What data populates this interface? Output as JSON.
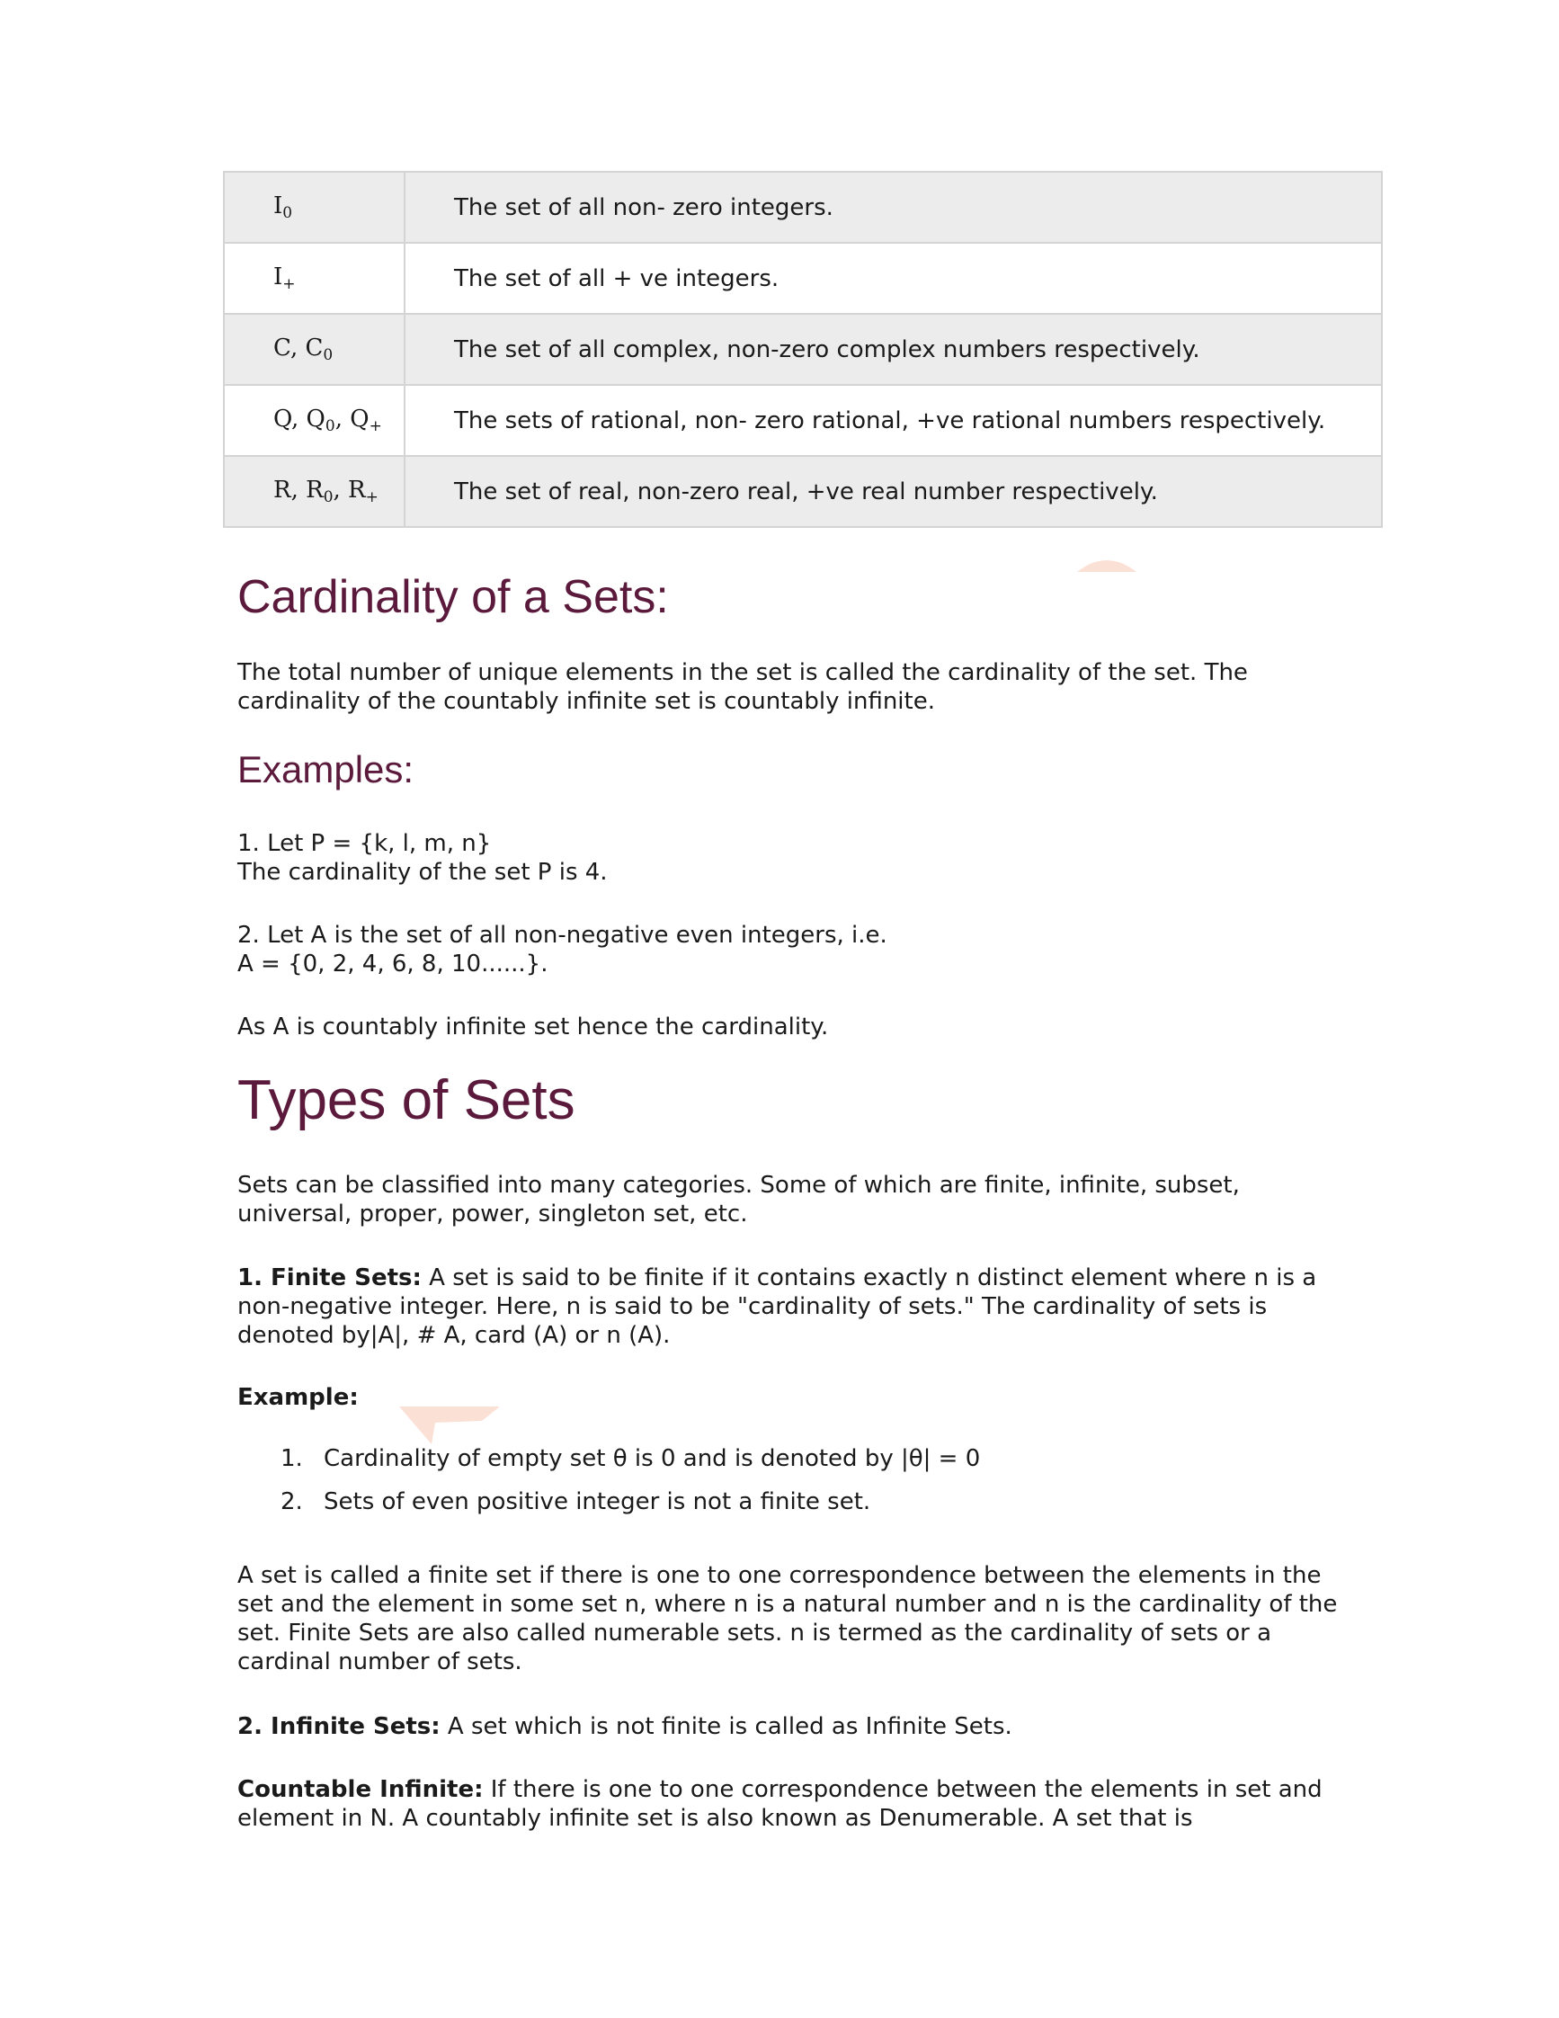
{
  "table": {
    "rows": [
      {
        "symbol": "I",
        "sub": "0",
        "desc": "The set of all non- zero integers."
      },
      {
        "symbol": "I",
        "sub": "+",
        "desc": "The set of all + ve integers."
      },
      {
        "symbol_html": "C, C<span class=\"sub\">0</span>",
        "desc": "The set of all complex, non-zero complex numbers respectively."
      },
      {
        "symbol_html": "Q, Q<span class=\"sub\">0</span>, Q<span class=\"sub\">+</span>",
        "desc": "The sets of rational, non- zero rational, +ve rational numbers respectively."
      },
      {
        "symbol_html": "R, R<span class=\"sub\">0</span>, R<span class=\"sub\">+</span>",
        "desc": "The set of real, non-zero real, +ve real number respectively."
      }
    ]
  },
  "cardinality": {
    "heading": "Cardinality of a Sets:",
    "text": "The total number of unique elements in the set is called the cardinality of the set. The cardinality of the countably infinite set is countably infinite."
  },
  "examples": {
    "heading": "Examples:",
    "ex1_line1": "1. Let P = {k, l, m, n}",
    "ex1_line2": "The cardinality of the set P is 4.",
    "ex2_line1": "2. Let A is the set of all non-negative even integers, i.e.",
    "ex2_line2": "A = {0, 2, 4, 6, 8, 10......}.",
    "ex3": "As A is countably infinite set hence the cardinality."
  },
  "types": {
    "heading": "Types of Sets",
    "intro": "Sets can be classified into many categories. Some of which are finite, infinite, subset, universal, proper, power, singleton set, etc.",
    "finite_label": "1. Finite Sets:",
    "finite_text": " A set is said to be finite if it contains exactly n distinct element where n is a non-negative integer. Here, n is said to be \"cardinality of sets.\" The cardinality of sets is denoted by|A|, # A, card (A) or n (A).",
    "example_label": "Example:",
    "example_items": [
      "Cardinality of empty set θ is 0 and is denoted by |θ| = 0",
      "Sets of even positive integer is not a finite set."
    ],
    "finite_more": "A set is called a finite set if there is one to one correspondence between the elements in the set and the element in some set n, where n is a natural number and n is the cardinality of the set. Finite Sets are also called numerable sets. n is termed as the cardinality of sets or a cardinal number of sets.",
    "infinite_label": "2. Infinite Sets:",
    "infinite_text": " A set which is not finite is called as Infinite Sets.",
    "countable_label": "Countable Infinite:",
    "countable_text": " If there is one to one correspondence between the elements in set and element in N. A countably infinite set is also known as Denumerable. A set that is"
  },
  "colors": {
    "heading": "#5b1a3b",
    "table_shade": "#ececec",
    "border": "#d4d4d4"
  }
}
